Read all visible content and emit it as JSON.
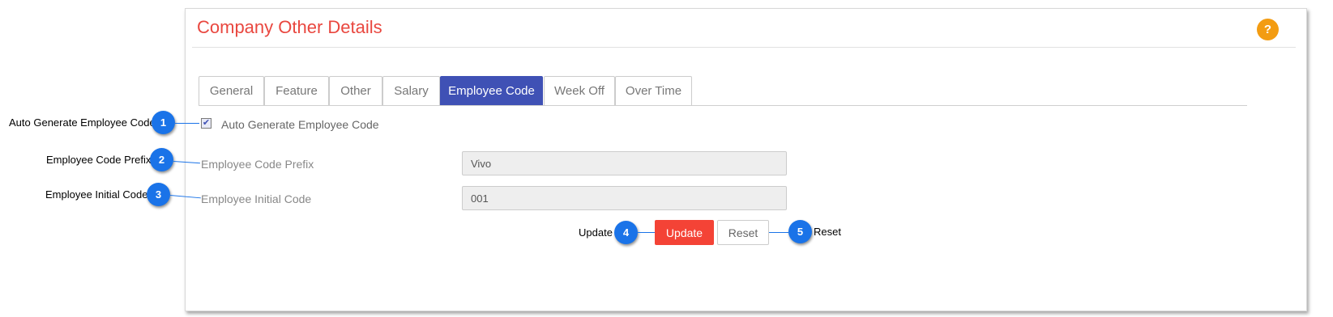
{
  "header": {
    "title": "Company Other Details",
    "help_icon_text": "?"
  },
  "tabs": [
    {
      "label": "General",
      "active": false
    },
    {
      "label": "Feature",
      "active": false
    },
    {
      "label": "Other",
      "active": false
    },
    {
      "label": "Salary",
      "active": false
    },
    {
      "label": "Employee Code",
      "active": true
    },
    {
      "label": "Week Off",
      "active": false
    },
    {
      "label": "Over Time",
      "active": false
    }
  ],
  "form": {
    "auto_generate": {
      "label": "Auto Generate Employee Code",
      "checked": true
    },
    "prefix": {
      "label": "Employee Code Prefix",
      "value": "Vivo"
    },
    "initial": {
      "label": "Employee Initial Code",
      "value": "001"
    },
    "update_label": "Update",
    "reset_label": "Reset"
  },
  "annotations": [
    {
      "number": "1",
      "text": "Auto Generate Employee Code"
    },
    {
      "number": "2",
      "text": "Employee Code Prefix"
    },
    {
      "number": "3",
      "text": "Employee Initial Code"
    },
    {
      "number": "4",
      "text": "Update"
    },
    {
      "number": "5",
      "text": "Reset"
    }
  ],
  "colors": {
    "title": "#e9473f",
    "active_tab": "#3f51b5",
    "update_button": "#f44336",
    "help_badge": "#f39c12",
    "annotation_badge": "#1a73e8"
  }
}
